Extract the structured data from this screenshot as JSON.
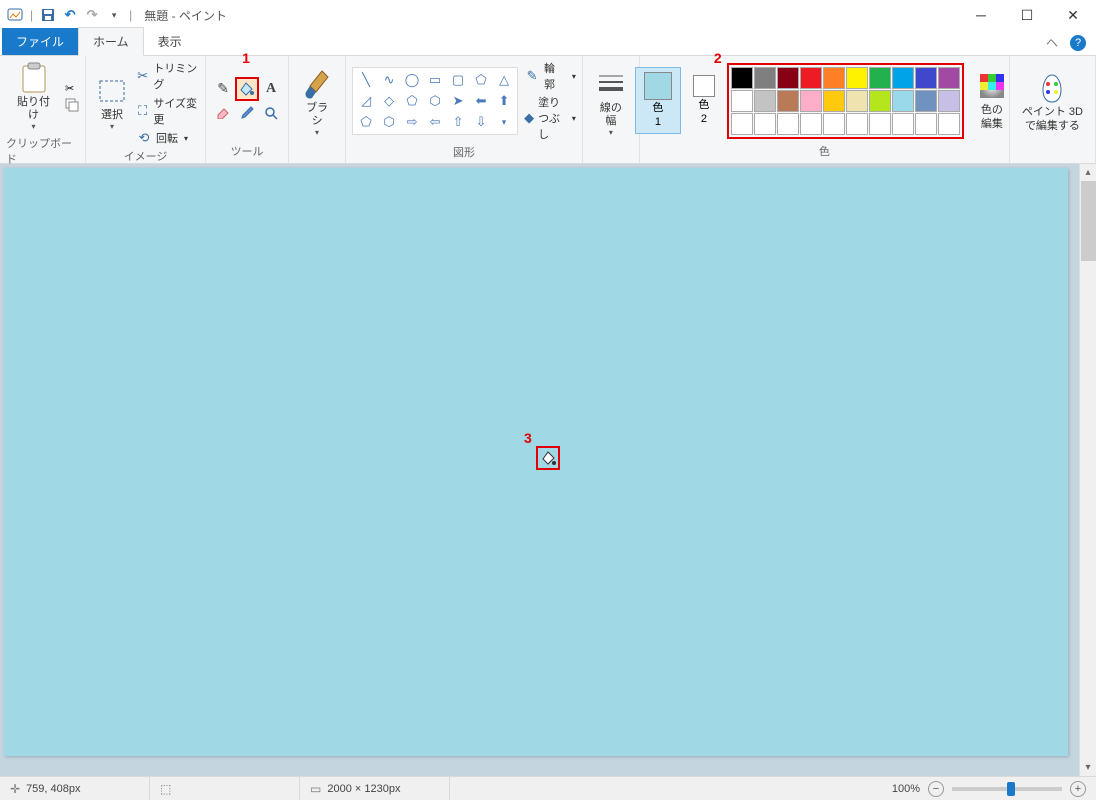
{
  "title": "無題 - ペイント",
  "tabs": {
    "file": "ファイル",
    "home": "ホーム",
    "view": "表示"
  },
  "groups": {
    "clipboard": {
      "label": "クリップボード",
      "paste": "貼り付け"
    },
    "image": {
      "label": "イメージ",
      "select": "選択",
      "crop": "トリミング",
      "resize": "サイズ変更",
      "rotate": "回転"
    },
    "tools": {
      "label": "ツール"
    },
    "brushes": {
      "label": "ブラシ"
    },
    "shapes": {
      "label": "図形",
      "outline": "輪郭",
      "fill": "塗りつぶし"
    },
    "stroke": {
      "label": "線の幅"
    },
    "colors": {
      "label": "色",
      "color1": "色\n1",
      "color2": "色\n2",
      "edit": "色の\n編集"
    },
    "paint3d": {
      "label2": "ペイント 3D\nで編集する"
    }
  },
  "palette": {
    "row1": [
      "#000000",
      "#7f7f7f",
      "#880015",
      "#ed1c24",
      "#ff7f27",
      "#fff200",
      "#22b14c",
      "#00a2e8",
      "#3f48cc",
      "#a349a4"
    ],
    "row2": [
      "#ffffff",
      "#c3c3c3",
      "#b97a57",
      "#ffaec9",
      "#ffc90e",
      "#efe4b0",
      "#b5e61d",
      "#99d9ea",
      "#7092be",
      "#c8bfe7"
    ],
    "row3": [
      "#ffffff",
      "#ffffff",
      "#ffffff",
      "#ffffff",
      "#ffffff",
      "#ffffff",
      "#ffffff",
      "#ffffff",
      "#ffffff",
      "#ffffff"
    ]
  },
  "annotations": {
    "a1": "1",
    "a2": "2",
    "a3": "3"
  },
  "status": {
    "coords": "759, 408px",
    "canvas_size": "2000 × 1230px",
    "zoom": "100%"
  }
}
